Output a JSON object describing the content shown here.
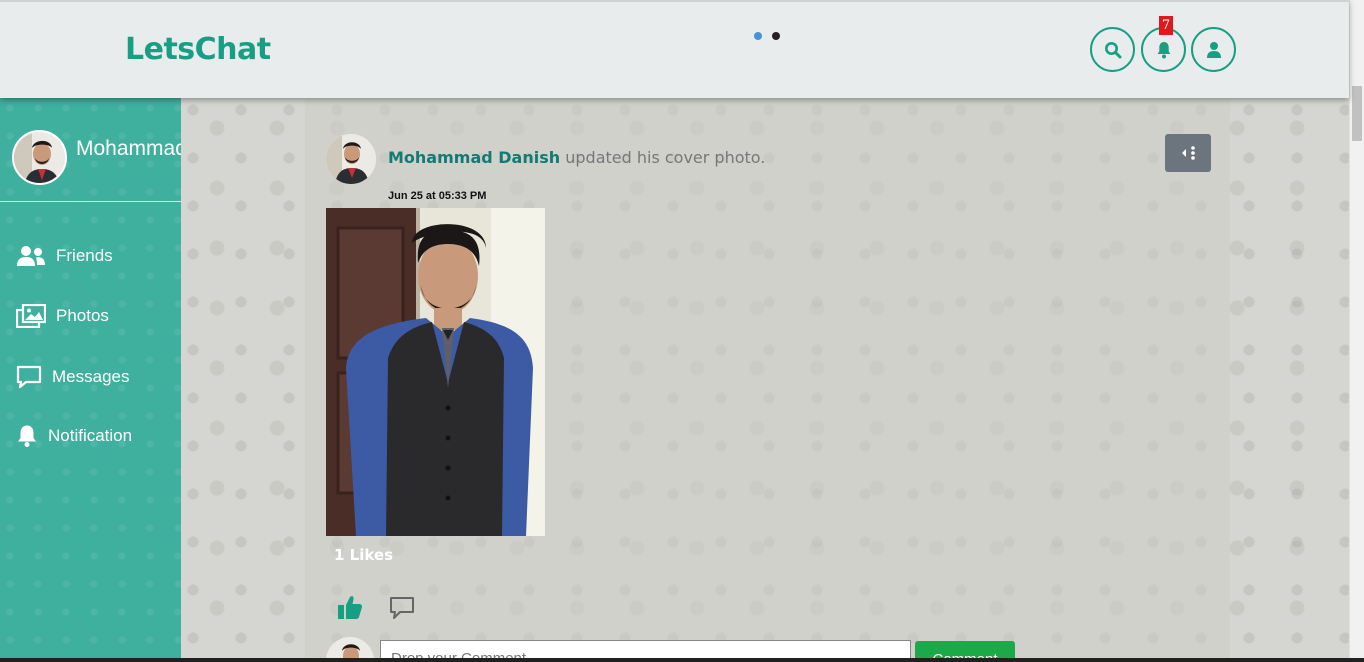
{
  "app": {
    "title": "LetsChat"
  },
  "header": {
    "carousel_dots": [
      {
        "color": "#4a90d9"
      },
      {
        "color": "#222222"
      }
    ],
    "notification_count": "7",
    "accent_color": "#179e83"
  },
  "sidebar": {
    "user_name": "Mohammad Danish",
    "items": [
      {
        "label": "Friends",
        "icon": "friends-icon"
      },
      {
        "label": "Photos",
        "icon": "photos-icon"
      },
      {
        "label": "Messages",
        "icon": "message-icon"
      },
      {
        "label": "Notification",
        "icon": "bell-icon"
      }
    ],
    "background_color": "#3fb09e"
  },
  "post": {
    "author": "Mohammad Danish",
    "action": "updated his cover photo.",
    "timestamp": "Jun 25 at 05:33 PM",
    "likes": "1 Likes",
    "comment_placeholder": "Drop your Comment",
    "comment_button": "Comment"
  }
}
